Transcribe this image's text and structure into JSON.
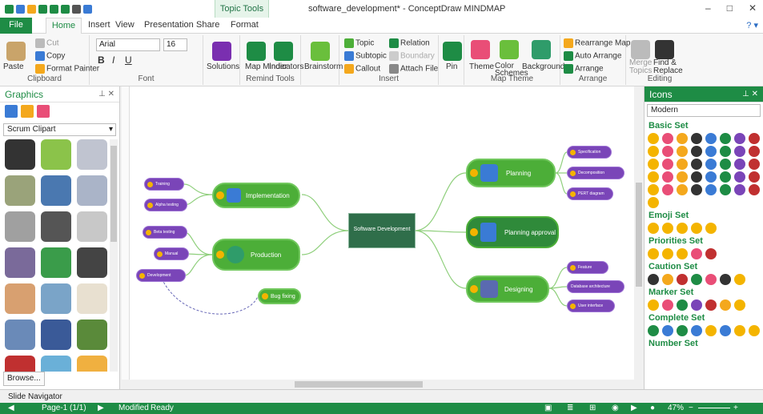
{
  "window": {
    "title": "software_development* - ConceptDraw MINDMAP",
    "context_tab": "Topic Tools",
    "controls": [
      "–",
      "□",
      "✕"
    ]
  },
  "tabs": [
    "File",
    "Home",
    "Insert",
    "View",
    "Presentation",
    "Share",
    "Format"
  ],
  "ribbon": {
    "clipboard": {
      "label": "Clipboard",
      "paste": "Paste",
      "cut": "Cut",
      "copy": "Copy",
      "format_painter": "Format Painter"
    },
    "font": {
      "label": "Font",
      "family": "Arial",
      "size": "16",
      "bold": "B",
      "italic": "I",
      "underline": "U"
    },
    "solutions": {
      "label": "Solutions"
    },
    "remind": {
      "label": "Remind Tools",
      "map_minder": "Map Minder",
      "indicators": "Indicators"
    },
    "brainstorm": {
      "label": "Brainstorm"
    },
    "insert": {
      "label": "Insert",
      "topic": "Topic",
      "relation": "Relation",
      "subtopic": "Subtopic",
      "boundary": "Boundary",
      "callout": "Callout",
      "attach": "Attach File"
    },
    "pin": {
      "label": "Pin"
    },
    "theme": {
      "label": "Map Theme",
      "theme": "Theme",
      "color": "Color Schemes",
      "background": "Background"
    },
    "arrange": {
      "label": "Arrange",
      "rearrange": "Rearrange Map",
      "auto": "Auto Arrange",
      "arrange": "Arrange"
    },
    "editing": {
      "label": "Editing",
      "merge": "Merge Topics",
      "find": "Find & Replace"
    }
  },
  "left_panel": {
    "title": "Graphics",
    "library": "Scrum Clipart",
    "browse": "Browse..."
  },
  "map": {
    "center": "Software Development",
    "main_topics": [
      {
        "label": "Implementation"
      },
      {
        "label": "Production"
      },
      {
        "label": "Bug fixing"
      },
      {
        "label": "Planning"
      },
      {
        "label": "Planning approval"
      },
      {
        "label": "Designing"
      }
    ],
    "subtopics": {
      "implementation": [
        "Training",
        "Alpha testing"
      ],
      "production": [
        "Beta testing",
        "Manual",
        "Development"
      ],
      "planning": [
        "Specification",
        "Decomposition",
        "PERT diagram"
      ],
      "designing": [
        "Feature",
        "Database architecture",
        "User interface"
      ]
    }
  },
  "right_panel": {
    "title": "Icons",
    "filter": "Modern",
    "sections": [
      "Basic Set",
      "Emoji Set",
      "Priorities Set",
      "Caution Set",
      "Marker Set",
      "Complete Set",
      "Number Set"
    ]
  },
  "slide_navigator": "Slide Navigator",
  "status": {
    "page": "Page-1 (1/1)",
    "state": "Modified",
    "ready": "Ready",
    "zoom": "47%"
  },
  "colors": {
    "brand": "#1e8c45",
    "topic_green": "#4cae38",
    "sub_purple": "#7a45b8",
    "center": "#2f6e4a"
  }
}
